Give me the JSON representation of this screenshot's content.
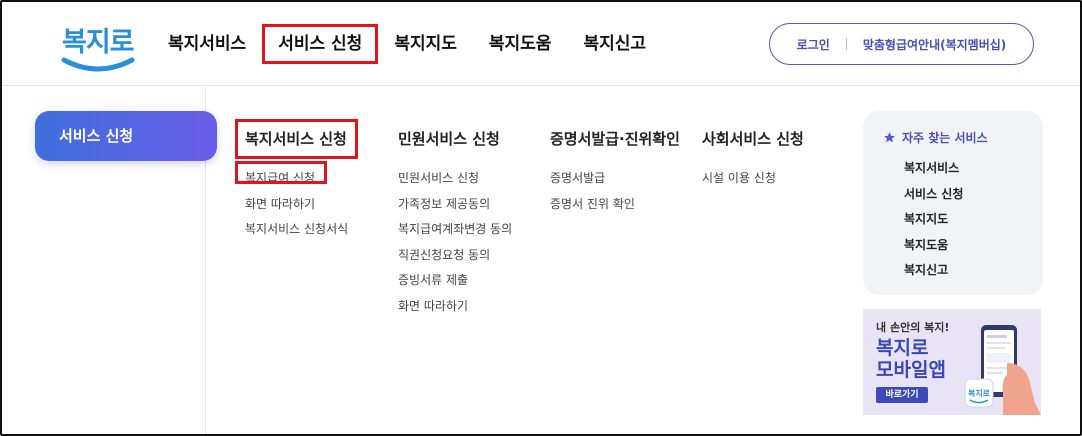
{
  "logo": {
    "text": "복지로"
  },
  "gnb": [
    {
      "label": "복지서비스"
    },
    {
      "label": "서비스 신청"
    },
    {
      "label": "복지지도"
    },
    {
      "label": "복지도움"
    },
    {
      "label": "복지신고"
    }
  ],
  "util": {
    "login": "로그인",
    "guide": "맞춤형급여안내(복지멤버십)"
  },
  "side": {
    "label": "서비스 신청"
  },
  "columns": [
    {
      "title": "복지서비스 신청",
      "items": [
        "복지급여 신청",
        "화면 따라하기",
        "복지서비스 신청서식"
      ]
    },
    {
      "title": "민원서비스 신청",
      "items": [
        "민원서비스 신청",
        "가족정보 제공동의",
        "복지급여계좌변경 동의",
        "직권신청요청 동의",
        "증빙서류 제출",
        "화면 따라하기"
      ]
    },
    {
      "title": "증명서발급·진위확인",
      "items": [
        "증명서발급",
        "증명서 진위 확인"
      ]
    },
    {
      "title": "사회서비스 신청",
      "items": [
        "시설 이용 신청"
      ]
    }
  ],
  "quick": {
    "title": "자주 찾는 서비스",
    "items": [
      "복지서비스",
      "서비스 신청",
      "복지지도",
      "복지도움",
      "복지신고"
    ]
  },
  "banner": {
    "sub": "내 손안의 복지!",
    "title_line1": "복지로",
    "title_line2": "모바일앱",
    "button": "바로가기",
    "phone_logo": "복지로"
  },
  "colors": {
    "accent": "#4a4fb5",
    "highlight": "#e0141e",
    "logo": "#2a8fd9"
  }
}
